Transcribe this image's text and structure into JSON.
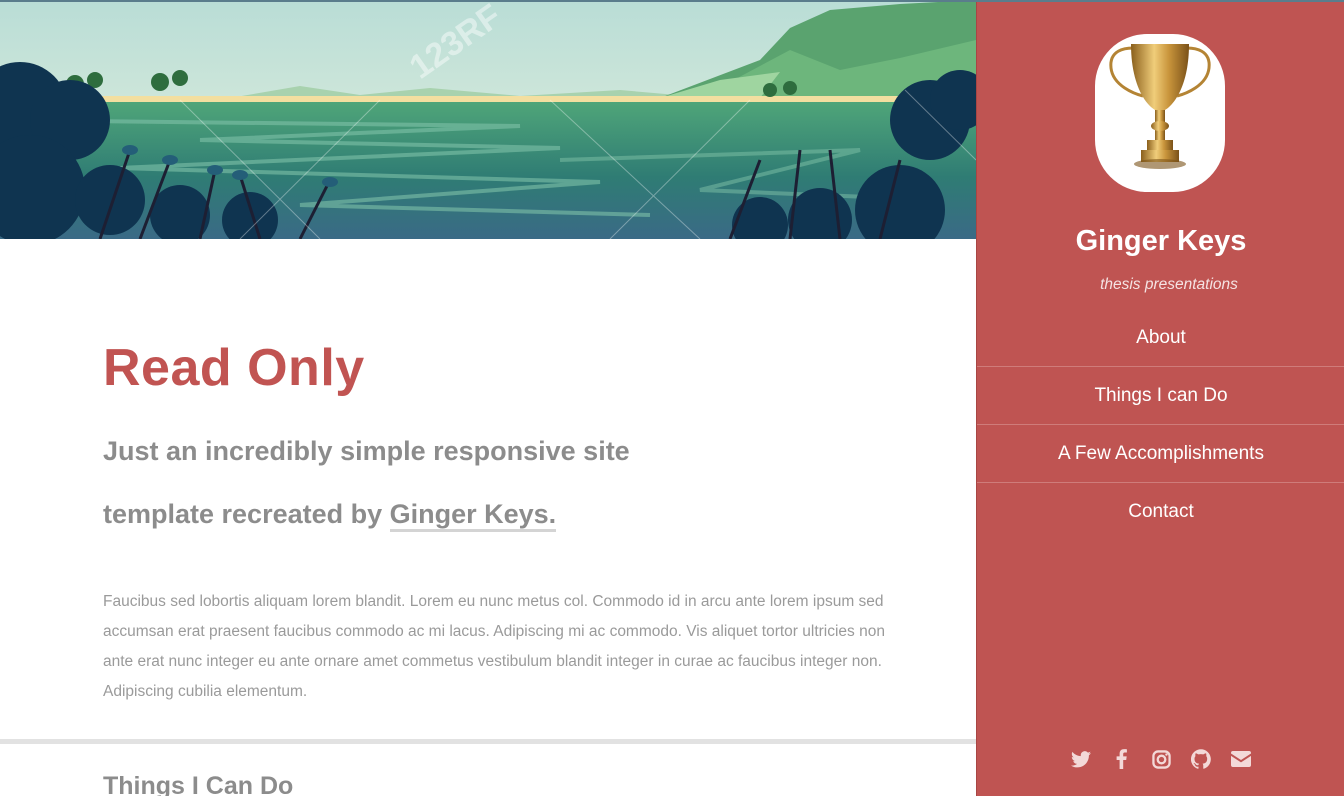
{
  "banner": {
    "image": "lake-landscape-illustration",
    "watermark": "123RF"
  },
  "intro": {
    "title": "Read Only",
    "subtitle_prefix": "Just an incredibly simple responsive site template recreated by ",
    "subtitle_link": "Ginger Keys.",
    "body": "Faucibus sed lobortis aliquam lorem blandit. Lorem eu nunc metus col. Commodo id in arcu ante lorem ipsum sed accumsan erat praesent faucibus commodo ac mi lacus. Adipiscing mi ac commodo. Vis aliquet tortor ultricies non ante erat nunc integer eu ante ornare amet commetus vestibulum blandit integer in curae ac faucibus integer non. Adipiscing cubilia elementum."
  },
  "next_section": {
    "title": "Things I Can Do"
  },
  "sidebar": {
    "avatar_icon": "trophy-icon",
    "title": "Ginger Keys",
    "subtitle": "thesis presentations",
    "nav": [
      {
        "label": "About"
      },
      {
        "label": "Things I can Do"
      },
      {
        "label": "A Few Accomplishments"
      },
      {
        "label": "Contact"
      }
    ],
    "socials": [
      "twitter-icon",
      "facebook-icon",
      "instagram-icon",
      "github-icon",
      "envelope-icon"
    ]
  },
  "colors": {
    "accent": "#bf5452",
    "text_muted": "#8c8c8c",
    "body_text": "#9a9a9a"
  }
}
